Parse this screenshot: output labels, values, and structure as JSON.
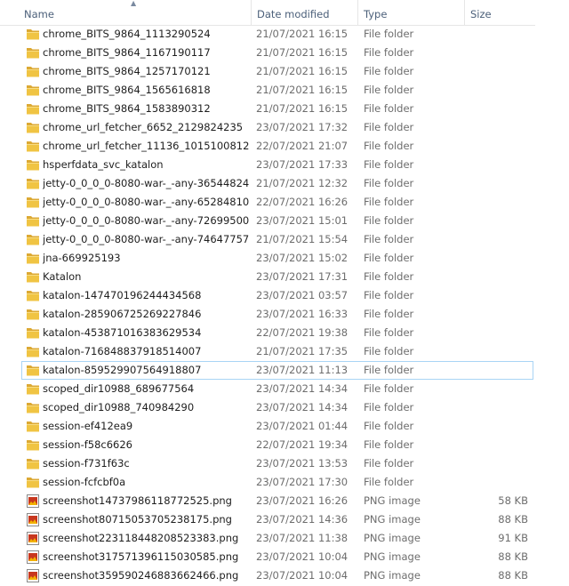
{
  "columns": {
    "name": "Name",
    "date": "Date modified",
    "type": "Type",
    "size": "Size"
  },
  "selected_index": 18,
  "icons": {
    "folder": "folder-icon",
    "image": "png-image-icon"
  },
  "colors": {
    "folder_front": "#f0c443",
    "folder_back": "#dca934",
    "selection_border": "#a9d4f5",
    "header_text": "#4c607a"
  },
  "files": [
    {
      "name": "chrome_BITS_9864_1113290524",
      "date": "21/07/2021 16:15",
      "type": "File folder",
      "size": "",
      "icon": "folder"
    },
    {
      "name": "chrome_BITS_9864_1167190117",
      "date": "21/07/2021 16:15",
      "type": "File folder",
      "size": "",
      "icon": "folder"
    },
    {
      "name": "chrome_BITS_9864_1257170121",
      "date": "21/07/2021 16:15",
      "type": "File folder",
      "size": "",
      "icon": "folder"
    },
    {
      "name": "chrome_BITS_9864_1565616818",
      "date": "21/07/2021 16:15",
      "type": "File folder",
      "size": "",
      "icon": "folder"
    },
    {
      "name": "chrome_BITS_9864_1583890312",
      "date": "21/07/2021 16:15",
      "type": "File folder",
      "size": "",
      "icon": "folder"
    },
    {
      "name": "chrome_url_fetcher_6652_2129824235",
      "date": "23/07/2021 17:32",
      "type": "File folder",
      "size": "",
      "icon": "folder"
    },
    {
      "name": "chrome_url_fetcher_11136_1015100812",
      "date": "22/07/2021 21:07",
      "type": "File folder",
      "size": "",
      "icon": "folder"
    },
    {
      "name": "hsperfdata_svc_katalon",
      "date": "23/07/2021 17:33",
      "type": "File folder",
      "size": "",
      "icon": "folder"
    },
    {
      "name": "jetty-0_0_0_0-8080-war-_-any-365448242...",
      "date": "21/07/2021 12:32",
      "type": "File folder",
      "size": "",
      "icon": "folder"
    },
    {
      "name": "jetty-0_0_0_0-8080-war-_-any-652848102...",
      "date": "22/07/2021 16:26",
      "type": "File folder",
      "size": "",
      "icon": "folder"
    },
    {
      "name": "jetty-0_0_0_0-8080-war-_-any-726995009...",
      "date": "23/07/2021 15:01",
      "type": "File folder",
      "size": "",
      "icon": "folder"
    },
    {
      "name": "jetty-0_0_0_0-8080-war-_-any-746477574...",
      "date": "21/07/2021 15:54",
      "type": "File folder",
      "size": "",
      "icon": "folder"
    },
    {
      "name": "jna-669925193",
      "date": "23/07/2021 15:02",
      "type": "File folder",
      "size": "",
      "icon": "folder"
    },
    {
      "name": "Katalon",
      "date": "23/07/2021 17:31",
      "type": "File folder",
      "size": "",
      "icon": "folder"
    },
    {
      "name": "katalon-147470196244434568",
      "date": "23/07/2021 03:57",
      "type": "File folder",
      "size": "",
      "icon": "folder"
    },
    {
      "name": "katalon-285906725269227846",
      "date": "23/07/2021 16:33",
      "type": "File folder",
      "size": "",
      "icon": "folder"
    },
    {
      "name": "katalon-453871016383629534",
      "date": "22/07/2021 19:38",
      "type": "File folder",
      "size": "",
      "icon": "folder"
    },
    {
      "name": "katalon-716848837918514007",
      "date": "21/07/2021 17:35",
      "type": "File folder",
      "size": "",
      "icon": "folder"
    },
    {
      "name": "katalon-859529907564918807",
      "date": "23/07/2021 11:13",
      "type": "File folder",
      "size": "",
      "icon": "folder"
    },
    {
      "name": "scoped_dir10988_689677564",
      "date": "23/07/2021 14:34",
      "type": "File folder",
      "size": "",
      "icon": "folder"
    },
    {
      "name": "scoped_dir10988_740984290",
      "date": "23/07/2021 14:34",
      "type": "File folder",
      "size": "",
      "icon": "folder"
    },
    {
      "name": "session-ef412ea9",
      "date": "23/07/2021 01:44",
      "type": "File folder",
      "size": "",
      "icon": "folder"
    },
    {
      "name": "session-f58c6626",
      "date": "22/07/2021 19:34",
      "type": "File folder",
      "size": "",
      "icon": "folder"
    },
    {
      "name": "session-f731f63c",
      "date": "23/07/2021 13:53",
      "type": "File folder",
      "size": "",
      "icon": "folder"
    },
    {
      "name": "session-fcfcbf0a",
      "date": "23/07/2021 17:30",
      "type": "File folder",
      "size": "",
      "icon": "folder"
    },
    {
      "name": "screenshot14737986118772525.png",
      "date": "23/07/2021 16:26",
      "type": "PNG image",
      "size": "58 KB",
      "icon": "image"
    },
    {
      "name": "screenshot80715053705238175.png",
      "date": "23/07/2021 14:36",
      "type": "PNG image",
      "size": "88 KB",
      "icon": "image"
    },
    {
      "name": "screenshot223118448208523383.png",
      "date": "23/07/2021 11:38",
      "type": "PNG image",
      "size": "91 KB",
      "icon": "image"
    },
    {
      "name": "screenshot317571396115030585.png",
      "date": "23/07/2021 10:04",
      "type": "PNG image",
      "size": "88 KB",
      "icon": "image"
    },
    {
      "name": "screenshot359590246883662466.png",
      "date": "23/07/2021 10:04",
      "type": "PNG image",
      "size": "88 KB",
      "icon": "image"
    }
  ]
}
